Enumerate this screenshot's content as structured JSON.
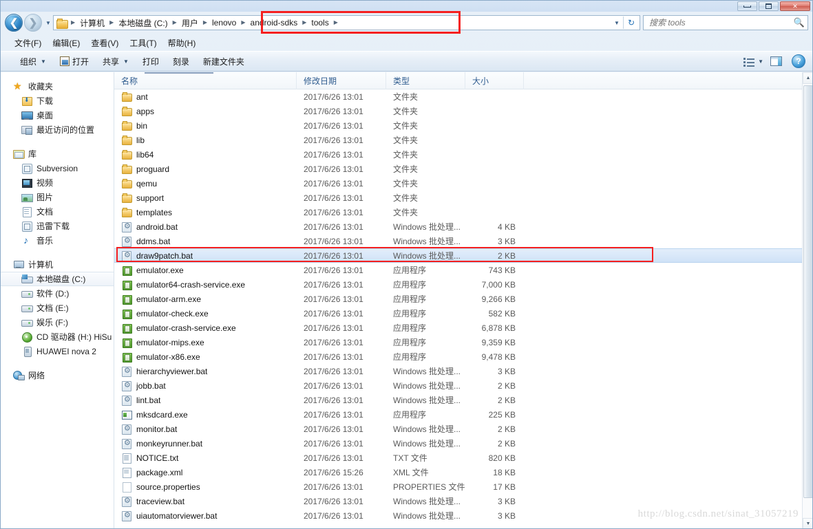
{
  "window": {
    "controls": {
      "minimize": "minimize-button",
      "maximize": "maximize-button",
      "close": "✕"
    }
  },
  "address_bar": {
    "back_arrow": "❮",
    "forward_arrow": "❯",
    "history_caret": "▼",
    "breadcrumbs": [
      "计算机",
      "本地磁盘 (C:)",
      "用户",
      "lenovo",
      "android-sdks",
      "tools"
    ],
    "separator": "▶",
    "dropdown_caret": "▼",
    "refresh_icon": "↻"
  },
  "search": {
    "placeholder": "搜索 tools",
    "value": "",
    "icon": "search-icon"
  },
  "menubar": {
    "items": [
      "文件(F)",
      "编辑(E)",
      "查看(V)",
      "工具(T)",
      "帮助(H)"
    ]
  },
  "toolbar": {
    "organize": "组织",
    "open": "打开",
    "share": "共享",
    "print": "打印",
    "burn": "刻录",
    "new_folder": "新建文件夹",
    "caret": "▼",
    "help": "?"
  },
  "sidebar": {
    "favorites": {
      "label": "收藏夹",
      "icon": "star-icon",
      "items": [
        {
          "label": "下载",
          "icon": "downloads-icon"
        },
        {
          "label": "桌面",
          "icon": "desktop-icon"
        },
        {
          "label": "最近访问的位置",
          "icon": "recent-places-icon"
        }
      ]
    },
    "libraries": {
      "label": "库",
      "icon": "library-icon",
      "items": [
        {
          "label": "Subversion",
          "icon": "document-icon"
        },
        {
          "label": "视频",
          "icon": "video-icon"
        },
        {
          "label": "图片",
          "icon": "picture-icon"
        },
        {
          "label": "文档",
          "icon": "document-icon"
        },
        {
          "label": "迅雷下载",
          "icon": "thunder-download-icon"
        },
        {
          "label": "音乐",
          "icon": "music-icon"
        }
      ]
    },
    "computer": {
      "label": "计算机",
      "icon": "computer-icon",
      "items": [
        {
          "label": "本地磁盘 (C:)",
          "icon": "windows-drive-icon",
          "selected": true
        },
        {
          "label": "软件 (D:)",
          "icon": "drive-icon",
          "selected": false
        },
        {
          "label": "文档 (E:)",
          "icon": "drive-icon",
          "selected": false
        },
        {
          "label": "娱乐 (F:)",
          "icon": "drive-icon",
          "selected": false
        },
        {
          "label": "CD 驱动器 (H:) HiSu",
          "icon": "cd-drive-icon",
          "selected": false
        },
        {
          "label": "HUAWEI nova 2",
          "icon": "phone-icon",
          "selected": false
        }
      ]
    },
    "network": {
      "label": "网络",
      "icon": "network-icon"
    }
  },
  "file_list": {
    "columns": [
      "名称",
      "修改日期",
      "类型",
      "大小"
    ],
    "rows": [
      {
        "name": "ant",
        "date": "2017/6/26 13:01",
        "type": "文件夹",
        "size": "",
        "icon": "folder"
      },
      {
        "name": "apps",
        "date": "2017/6/26 13:01",
        "type": "文件夹",
        "size": "",
        "icon": "folder"
      },
      {
        "name": "bin",
        "date": "2017/6/26 13:01",
        "type": "文件夹",
        "size": "",
        "icon": "folder"
      },
      {
        "name": "lib",
        "date": "2017/6/26 13:01",
        "type": "文件夹",
        "size": "",
        "icon": "folder"
      },
      {
        "name": "lib64",
        "date": "2017/6/26 13:01",
        "type": "文件夹",
        "size": "",
        "icon": "folder"
      },
      {
        "name": "proguard",
        "date": "2017/6/26 13:01",
        "type": "文件夹",
        "size": "",
        "icon": "folder"
      },
      {
        "name": "qemu",
        "date": "2017/6/26 13:01",
        "type": "文件夹",
        "size": "",
        "icon": "folder"
      },
      {
        "name": "support",
        "date": "2017/6/26 13:01",
        "type": "文件夹",
        "size": "",
        "icon": "folder"
      },
      {
        "name": "templates",
        "date": "2017/6/26 13:01",
        "type": "文件夹",
        "size": "",
        "icon": "folder"
      },
      {
        "name": "android.bat",
        "date": "2017/6/26 13:01",
        "type": "Windows 批处理...",
        "size": "4 KB",
        "icon": "bat"
      },
      {
        "name": "ddms.bat",
        "date": "2017/6/26 13:01",
        "type": "Windows 批处理...",
        "size": "3 KB",
        "icon": "bat"
      },
      {
        "name": "draw9patch.bat",
        "date": "2017/6/26 13:01",
        "type": "Windows 批处理...",
        "size": "2 KB",
        "icon": "bat",
        "selected": true
      },
      {
        "name": "emulator.exe",
        "date": "2017/6/26 13:01",
        "type": "应用程序",
        "size": "743 KB",
        "icon": "exe"
      },
      {
        "name": "emulator64-crash-service.exe",
        "date": "2017/6/26 13:01",
        "type": "应用程序",
        "size": "7,000 KB",
        "icon": "exe"
      },
      {
        "name": "emulator-arm.exe",
        "date": "2017/6/26 13:01",
        "type": "应用程序",
        "size": "9,266 KB",
        "icon": "exe"
      },
      {
        "name": "emulator-check.exe",
        "date": "2017/6/26 13:01",
        "type": "应用程序",
        "size": "582 KB",
        "icon": "exe"
      },
      {
        "name": "emulator-crash-service.exe",
        "date": "2017/6/26 13:01",
        "type": "应用程序",
        "size": "6,878 KB",
        "icon": "exe"
      },
      {
        "name": "emulator-mips.exe",
        "date": "2017/6/26 13:01",
        "type": "应用程序",
        "size": "9,359 KB",
        "icon": "exe"
      },
      {
        "name": "emulator-x86.exe",
        "date": "2017/6/26 13:01",
        "type": "应用程序",
        "size": "9,478 KB",
        "icon": "exe"
      },
      {
        "name": "hierarchyviewer.bat",
        "date": "2017/6/26 13:01",
        "type": "Windows 批处理...",
        "size": "3 KB",
        "icon": "bat"
      },
      {
        "name": "jobb.bat",
        "date": "2017/6/26 13:01",
        "type": "Windows 批处理...",
        "size": "2 KB",
        "icon": "bat"
      },
      {
        "name": "lint.bat",
        "date": "2017/6/26 13:01",
        "type": "Windows 批处理...",
        "size": "2 KB",
        "icon": "bat"
      },
      {
        "name": "mksdcard.exe",
        "date": "2017/6/26 13:01",
        "type": "应用程序",
        "size": "225 KB",
        "icon": "exe2"
      },
      {
        "name": "monitor.bat",
        "date": "2017/6/26 13:01",
        "type": "Windows 批处理...",
        "size": "2 KB",
        "icon": "bat"
      },
      {
        "name": "monkeyrunner.bat",
        "date": "2017/6/26 13:01",
        "type": "Windows 批处理...",
        "size": "2 KB",
        "icon": "bat"
      },
      {
        "name": "NOTICE.txt",
        "date": "2017/6/26 13:01",
        "type": "TXT 文件",
        "size": "820 KB",
        "icon": "txt"
      },
      {
        "name": "package.xml",
        "date": "2017/6/26 15:26",
        "type": "XML 文件",
        "size": "18 KB",
        "icon": "xml"
      },
      {
        "name": "source.properties",
        "date": "2017/6/26 13:01",
        "type": "PROPERTIES 文件",
        "size": "17 KB",
        "icon": "blank"
      },
      {
        "name": "traceview.bat",
        "date": "2017/6/26 13:01",
        "type": "Windows 批处理...",
        "size": "3 KB",
        "icon": "bat"
      },
      {
        "name": "uiautomatorviewer.bat",
        "date": "2017/6/26 13:01",
        "type": "Windows 批处理...",
        "size": "3 KB",
        "icon": "bat"
      }
    ]
  },
  "scrollbar": {
    "up": "▲",
    "down": "▼"
  },
  "watermark": {
    "text": "http://blog.csdn.net/sinat_31057219"
  },
  "colors": {
    "annotation": "#f52020",
    "selection": "#cfe2f7",
    "header_text": "#2f5c8f"
  }
}
